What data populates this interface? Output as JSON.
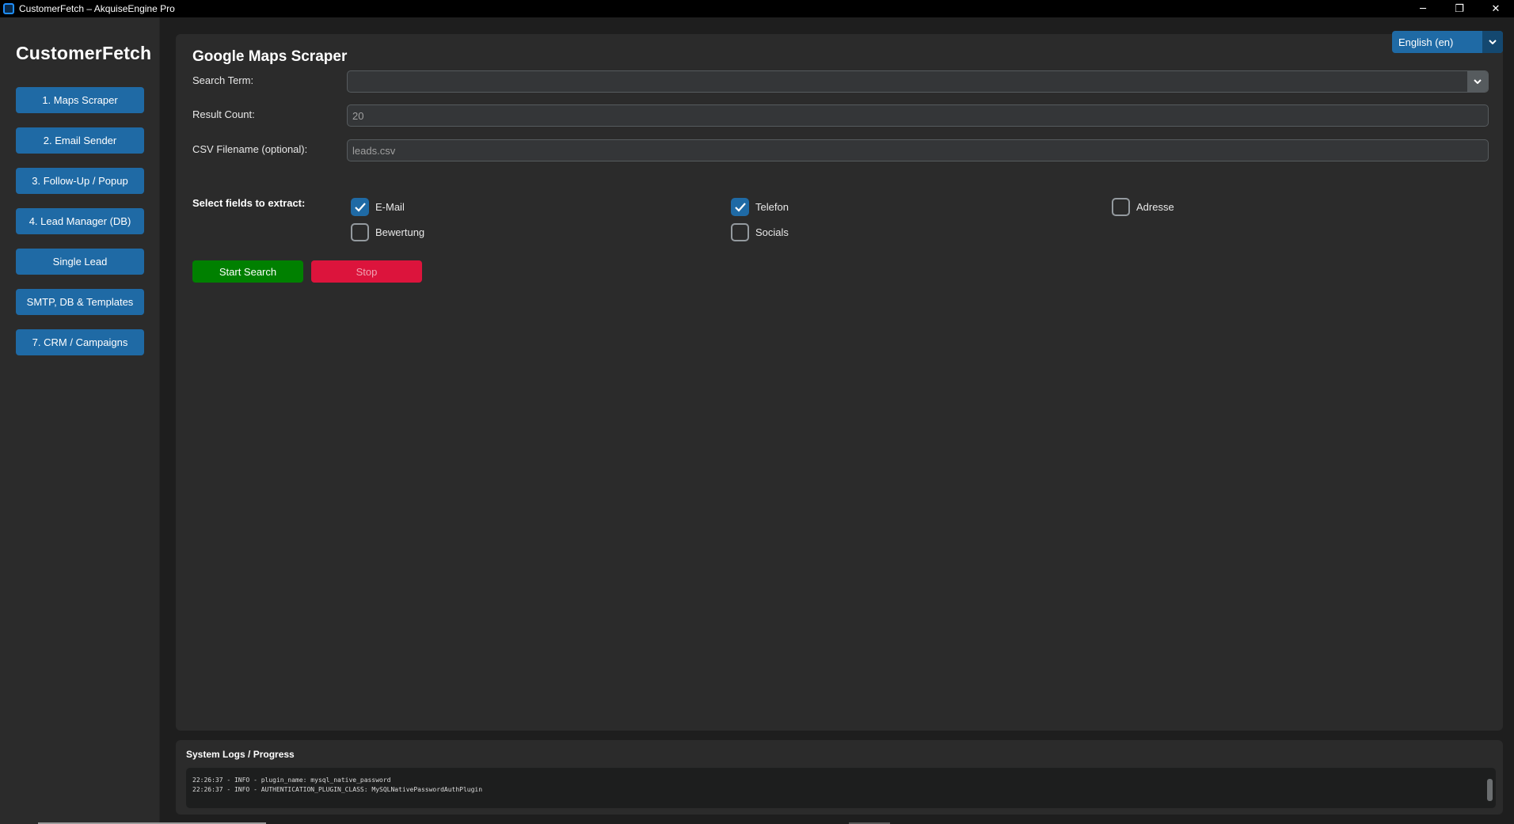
{
  "window": {
    "title": "CustomerFetch – AkquiseEngine Pro",
    "minimize_glyph": "─",
    "restore_glyph": "❐",
    "close_glyph": "✕"
  },
  "sidebar": {
    "brand": "CustomerFetch",
    "items": [
      {
        "label": "1. Maps Scraper"
      },
      {
        "label": "2. Email Sender"
      },
      {
        "label": "3. Follow-Up / Popup"
      },
      {
        "label": "4. Lead Manager (DB)"
      },
      {
        "label": "Single Lead"
      },
      {
        "label": "SMTP, DB & Templates"
      },
      {
        "label": "7. CRM / Campaigns"
      }
    ]
  },
  "main": {
    "title": "Google Maps Scraper",
    "language": {
      "selected": "English (en)",
      "icon": "chevron-down-icon"
    },
    "search_term": {
      "label": "Search Term:",
      "value": ""
    },
    "result_count": {
      "label": "Result Count:",
      "value": "20"
    },
    "csv_filename": {
      "label": "CSV Filename (optional):",
      "value": "leads.csv"
    },
    "fields_label": "Select fields to extract:",
    "fields": [
      {
        "label": "E-Mail",
        "checked": true
      },
      {
        "label": "Telefon",
        "checked": true
      },
      {
        "label": "Adresse",
        "checked": false
      },
      {
        "label": "Bewertung",
        "checked": false
      },
      {
        "label": "Socials",
        "checked": false
      }
    ],
    "start_label": "Start Search",
    "stop_label": "Stop"
  },
  "logs": {
    "title": "System Logs / Progress",
    "lines": [
      "22:26:37 - INFO - plugin_name: mysql_native_password",
      "22:26:37 - INFO - AUTHENTICATION_PLUGIN_CLASS: MySQLNativePasswordAuthPlugin"
    ]
  },
  "colors": {
    "accent": "#1f6aa5",
    "start": "#008000",
    "stop": "#dc143c"
  }
}
